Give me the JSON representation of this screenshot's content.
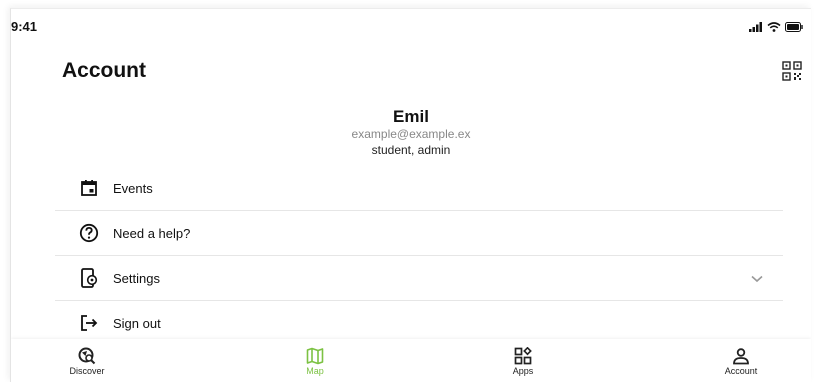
{
  "status_bar": {
    "time": "9:41"
  },
  "header": {
    "title": "Account"
  },
  "profile": {
    "name": "Emil",
    "email": "example@example.ex",
    "roles": "student, admin"
  },
  "menu": {
    "items": [
      {
        "label": "Events",
        "icon": "calendar-icon"
      },
      {
        "label": "Need a help?",
        "icon": "help-circle-icon"
      },
      {
        "label": "Settings",
        "icon": "settings-device-icon",
        "expandable": true
      },
      {
        "label": "Sign out",
        "icon": "sign-out-icon"
      }
    ]
  },
  "tabbar": {
    "items": [
      {
        "label": "Discover",
        "icon": "discover-icon"
      },
      {
        "label": "Map",
        "icon": "map-icon",
        "active": true
      },
      {
        "label": "Apps",
        "icon": "apps-icon"
      },
      {
        "label": "Account",
        "icon": "person-icon"
      }
    ]
  },
  "colors": {
    "accent": "#7cc243",
    "text": "#111111",
    "muted": "#888888"
  }
}
